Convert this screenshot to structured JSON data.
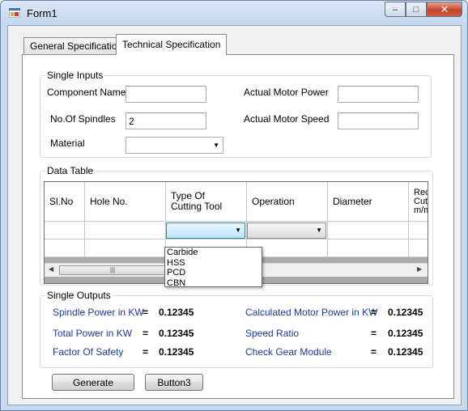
{
  "window": {
    "title": "Form1",
    "minimize_glyph": "–",
    "maximize_glyph": "□",
    "close_glyph": "✕"
  },
  "tabs": [
    {
      "label": "General Specification",
      "selected": false
    },
    {
      "label": "Technical Specification",
      "selected": true
    }
  ],
  "single_inputs": {
    "title": "Single Inputs",
    "component_name_label": "Component Name",
    "component_name_value": "",
    "spindles_label": "No.Of Spindles",
    "spindles_value": "2",
    "material_label": "Material",
    "material_value": "",
    "motor_power_label": "Actual Motor Power",
    "motor_power_value": "",
    "motor_speed_label": "Actual Motor Speed",
    "motor_speed_value": ""
  },
  "data_table": {
    "title": "Data Table",
    "columns": [
      "Sl.No",
      "Hole No.",
      "Type Of\nCutting Tool",
      "Operation",
      "Diameter",
      "Rec\nCut\nm/m"
    ],
    "cutting_tool_options": [
      "Carbide",
      "HSS",
      "PCD",
      "CBN"
    ]
  },
  "single_outputs": {
    "title": "Single Outputs",
    "eq": "=",
    "items": [
      {
        "label": "Spindle Power in KW",
        "value": "0.12345"
      },
      {
        "label": "Total Power in KW",
        "value": "0.12345"
      },
      {
        "label": "Factor Of Safety",
        "value": "0.12345"
      },
      {
        "label": "Calculated Motor Power in KW",
        "value": "0.12345"
      },
      {
        "label": "Speed Ratio",
        "value": "0.12345"
      },
      {
        "label": "Check Gear Module",
        "value": "0.12345"
      }
    ]
  },
  "buttons": {
    "generate": "Generate",
    "button3": "Button3"
  },
  "colors": {
    "output_label": "#1a3a9c",
    "titlebar": "#c9daef",
    "close_button": "#c7432b"
  }
}
